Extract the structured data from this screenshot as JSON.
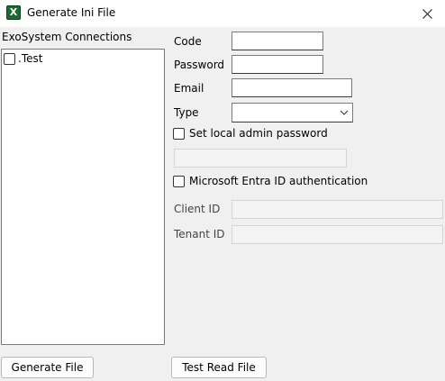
{
  "window": {
    "title": "Generate Ini File",
    "icon_glyph": "X",
    "icon": "excel-app-icon"
  },
  "connections": {
    "header": "ExoSystem Connections",
    "items": [
      {
        "label": ".Test",
        "checked": false
      }
    ]
  },
  "form": {
    "code_label": "Code",
    "code_value": "",
    "password_label": "Password",
    "password_value": "",
    "email_label": "Email",
    "email_value": "",
    "type_label": "Type",
    "type_value": "",
    "set_local_admin_label": "Set local admin password",
    "set_local_admin_checked": false,
    "admin_password_value": "",
    "entra_label": "Microsoft Entra ID authentication",
    "entra_checked": false,
    "client_id_label": "Client ID",
    "client_id_value": "",
    "tenant_id_label": "Tenant ID",
    "tenant_id_value": ""
  },
  "buttons": {
    "generate_label": "Generate File",
    "test_read_label": "Test Read File"
  }
}
